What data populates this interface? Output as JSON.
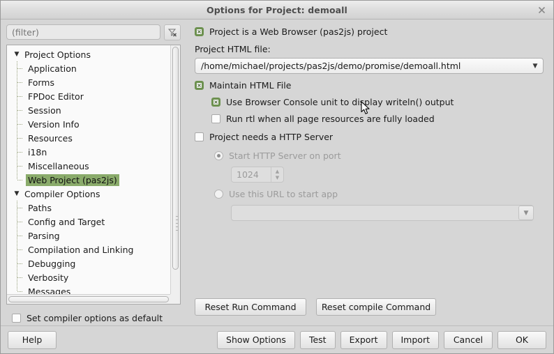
{
  "window": {
    "title": "Options for Project: demoall",
    "close_icon": "close-icon"
  },
  "sidebar": {
    "filter": {
      "value": "",
      "placeholder": "(filter)",
      "clear_icon": "filter-clear-icon"
    },
    "tree": [
      {
        "label": "Project Options",
        "level": 0,
        "expanded": true,
        "selected": false
      },
      {
        "label": "Application",
        "level": 1,
        "selected": false
      },
      {
        "label": "Forms",
        "level": 1,
        "selected": false
      },
      {
        "label": "FPDoc Editor",
        "level": 1,
        "selected": false
      },
      {
        "label": "Session",
        "level": 1,
        "selected": false
      },
      {
        "label": "Version Info",
        "level": 1,
        "selected": false
      },
      {
        "label": "Resources",
        "level": 1,
        "selected": false
      },
      {
        "label": "i18n",
        "level": 1,
        "selected": false
      },
      {
        "label": "Miscellaneous",
        "level": 1,
        "selected": false
      },
      {
        "label": "Web Project (pas2js)",
        "level": 1,
        "selected": true
      },
      {
        "label": "Compiler Options",
        "level": 0,
        "expanded": true,
        "selected": false
      },
      {
        "label": "Paths",
        "level": 1,
        "selected": false
      },
      {
        "label": "Config and Target",
        "level": 1,
        "selected": false
      },
      {
        "label": "Parsing",
        "level": 1,
        "selected": false
      },
      {
        "label": "Compilation and Linking",
        "level": 1,
        "selected": false
      },
      {
        "label": "Debugging",
        "level": 1,
        "selected": false
      },
      {
        "label": "Verbosity",
        "level": 1,
        "selected": false
      },
      {
        "label": "Messages",
        "level": 1,
        "selected": false
      }
    ],
    "set_default": {
      "label": "Set compiler options as default",
      "checked": false
    }
  },
  "main": {
    "is_web_browser_project": {
      "label": "Project is a Web Browser (pas2js) project",
      "checked": true
    },
    "html_file": {
      "caption": "Project HTML file:",
      "value": "/home/michael/projects/pas2js/demo/promise/demoall.html"
    },
    "maintain_html": {
      "label": "Maintain HTML File",
      "checked": true
    },
    "browser_console": {
      "label": "Use Browser Console unit to display writeln() output",
      "checked": true
    },
    "run_rtl_loaded": {
      "label": "Run rtl when all page resources are fully loaded",
      "checked": false
    },
    "http_server": {
      "label": "Project needs a HTTP Server",
      "checked": false
    },
    "start_http_server": {
      "label": "Start HTTP Server on port",
      "selected": true,
      "port": "1024"
    },
    "use_url": {
      "label": "Use this URL to start app",
      "selected": false,
      "value": ""
    },
    "reset_run_command": "Reset Run Command",
    "reset_compile_command": "Reset compile Command"
  },
  "footer": {
    "help": "Help",
    "show_options": "Show Options",
    "test": "Test",
    "export": "Export",
    "import": "Import",
    "cancel": "Cancel",
    "ok": "OK"
  },
  "colors": {
    "selection_green": "#8aab6b",
    "checkbox_green": "#6d9150",
    "window_bg": "#d6d6d6",
    "tree_bg": "#fafafa"
  }
}
